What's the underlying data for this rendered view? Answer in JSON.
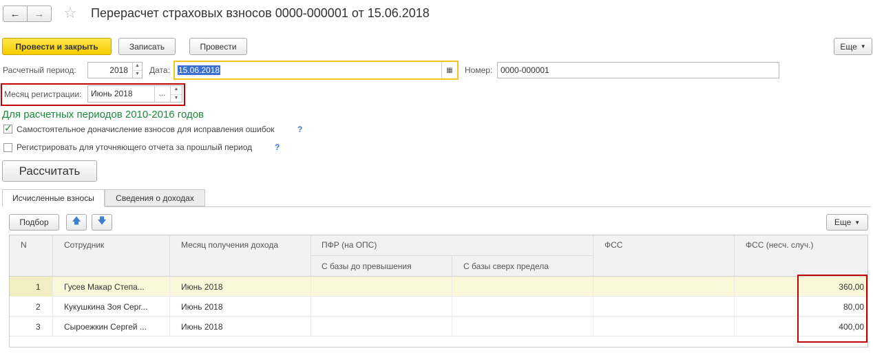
{
  "window": {
    "title": "Перерасчет страховых взносов 0000-000001 от 15.06.2018",
    "back_icon": "arrow-left-icon",
    "forward_icon": "arrow-right-icon",
    "star_icon": "star-icon"
  },
  "toolbar": {
    "post_close_label": "Провести и закрыть",
    "save_label": "Записать",
    "post_label": "Провести",
    "more_label": "Еще"
  },
  "form": {
    "period_label": "Расчетный период:",
    "period_value": "2018",
    "date_label": "Дата:",
    "date_value": "15.06.2018",
    "number_label": "Номер:",
    "number_value": "0000-000001",
    "reg_month_label": "Месяц регистрации:",
    "reg_month_value": "Июнь 2018",
    "reg_month_select": "...",
    "section_heading": "Для расчетных периодов 2010-2016 годов",
    "checkbox1_label": "Самостоятельное доначисление взносов для исправления ошибок",
    "checkbox1_checked": true,
    "checkbox2_label": "Регистрировать для уточняющего отчета за прошлый период",
    "checkbox2_checked": false,
    "help_mark": "?",
    "calculate_label": "Рассчитать"
  },
  "tabs": [
    {
      "label": "Исчисленные взносы",
      "active": true
    },
    {
      "label": "Сведения о доходах",
      "active": false
    }
  ],
  "table_toolbar": {
    "select_label": "Подбор",
    "more_label": "Еще"
  },
  "table": {
    "headers": {
      "n": "N",
      "employee": "Сотрудник",
      "month": "Месяц получения дохода",
      "pfr": "ПФР (на ОПС)",
      "pfr_base_below": "С базы до превышения",
      "pfr_base_above": "С базы сверх предела",
      "fss": "ФСС",
      "fss_ns": "ФСС (несч. случ.)"
    },
    "rows": [
      {
        "n": "1",
        "employee": "Гусев Макар  Степа...",
        "month": "Июнь 2018",
        "fss_ns": "360,00"
      },
      {
        "n": "2",
        "employee": "Кукушкина Зоя Серг...",
        "month": "Июнь 2018",
        "fss_ns": "80,00"
      },
      {
        "n": "3",
        "employee": "Сыроежкин Сергей ...",
        "month": "Июнь 2018",
        "fss_ns": "400,00"
      }
    ]
  },
  "colors": {
    "primary_button": "#f6cc00",
    "highlight_border": "#c00000",
    "focus_border": "#f0c419",
    "section_heading": "#1a8a3a",
    "selected_row": "#fbf8d9",
    "help": "#3c78c8"
  }
}
